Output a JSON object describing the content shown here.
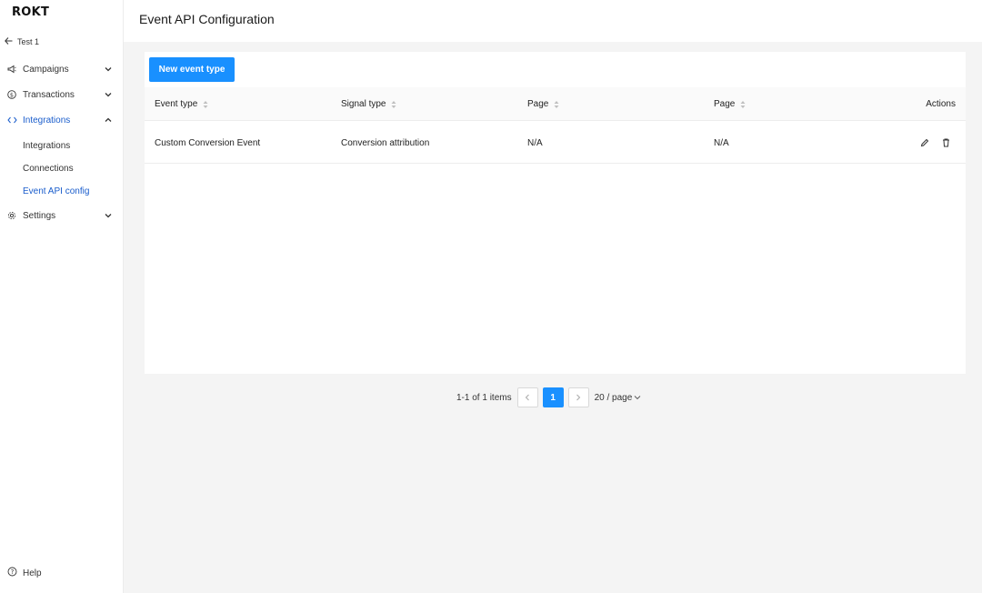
{
  "brand": {
    "logo_text": "ROKT"
  },
  "sidebar": {
    "back_label": "Test 1",
    "items": [
      {
        "label": "Campaigns",
        "icon": "megaphone-icon",
        "expanded": false
      },
      {
        "label": "Transactions",
        "icon": "dollar-circle-icon",
        "expanded": false
      },
      {
        "label": "Integrations",
        "icon": "code-icon",
        "expanded": true,
        "active": true
      },
      {
        "label": "Settings",
        "icon": "gear-icon",
        "expanded": false
      }
    ],
    "sub_items": [
      {
        "label": "Integrations"
      },
      {
        "label": "Connections"
      },
      {
        "label": "Event API config",
        "active": true
      }
    ],
    "help_label": "Help"
  },
  "header": {
    "title": "Event API Configuration"
  },
  "toolbar": {
    "new_button_label": "New event type"
  },
  "table": {
    "columns": [
      "Event type",
      "Signal type",
      "Page",
      "Page",
      "Actions"
    ],
    "rows": [
      {
        "event_type": "Custom Conversion Event",
        "signal_type": "Conversion attribution",
        "page1": "N/A",
        "page2": "N/A"
      }
    ]
  },
  "pagination": {
    "total_text": "1-1 of 1 items",
    "current_page": "1",
    "page_size": "20 / page"
  },
  "colors": {
    "accent": "#1990ff",
    "active_nav": "#1a5dcc",
    "background": "#f4f4f4"
  }
}
